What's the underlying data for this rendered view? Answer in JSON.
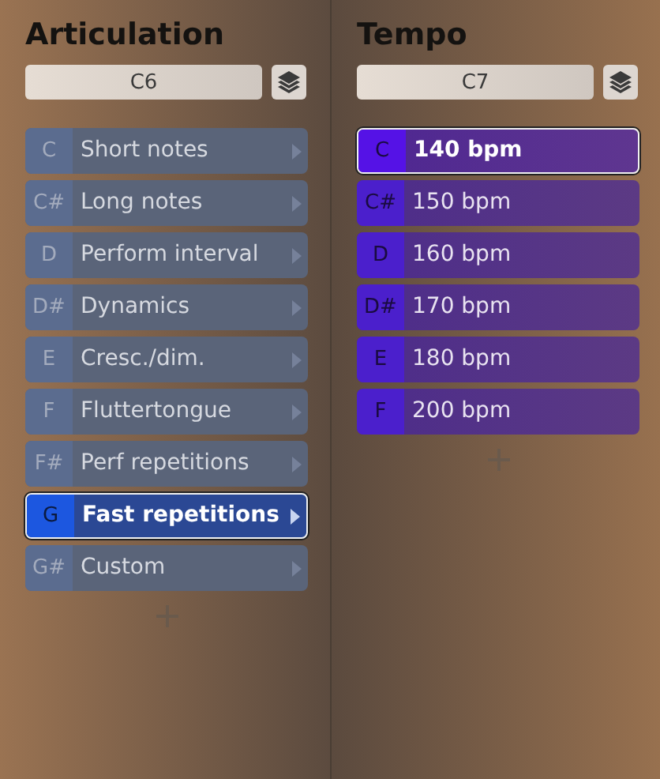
{
  "panels": [
    {
      "kind": "articulation",
      "title": "Articulation",
      "field": {
        "value": "C6"
      },
      "items": [
        {
          "key": "C",
          "label": "Short notes",
          "selected": false
        },
        {
          "key": "C#",
          "label": "Long notes",
          "selected": false
        },
        {
          "key": "D",
          "label": "Perform interval",
          "selected": false
        },
        {
          "key": "D#",
          "label": "Dynamics",
          "selected": false
        },
        {
          "key": "E",
          "label": "Cresc./dim.",
          "selected": false
        },
        {
          "key": "F",
          "label": "Fluttertongue",
          "selected": false
        },
        {
          "key": "F#",
          "label": "Perf repetitions",
          "selected": false
        },
        {
          "key": "G",
          "label": "Fast repetitions",
          "selected": true
        },
        {
          "key": "G#",
          "label": "Custom",
          "selected": false
        }
      ]
    },
    {
      "kind": "tempo",
      "title": "Tempo",
      "field": {
        "value": "C7"
      },
      "items": [
        {
          "key": "C",
          "label": "140 bpm",
          "selected": true
        },
        {
          "key": "C#",
          "label": "150 bpm",
          "selected": false
        },
        {
          "key": "D",
          "label": "160 bpm",
          "selected": false
        },
        {
          "key": "D#",
          "label": "170 bpm",
          "selected": false
        },
        {
          "key": "E",
          "label": "180 bpm",
          "selected": false
        },
        {
          "key": "F",
          "label": "200 bpm",
          "selected": false
        }
      ]
    }
  ]
}
